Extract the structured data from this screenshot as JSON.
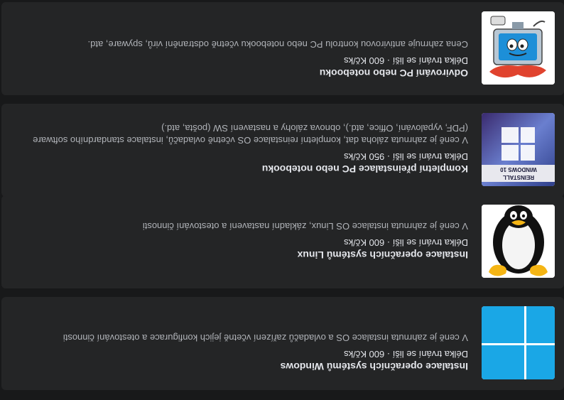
{
  "services": [
    {
      "title": "Instalace operačních systémů Windows",
      "meta": "Délka trvání se liší · 600 Kč/ks",
      "description": "V ceně je zahrnuta instalace OS a ovladačů zařízení včetně jejich konfigurace a otestování činnosti",
      "image_icon": "windows-logo-icon"
    },
    {
      "title": "Instalace operačních systémů Linux",
      "meta": "Délka trvání se liší · 600 Kč/ks",
      "description": "V ceně je zahrnuta instalace OS Linux, základní nastavení a otestování činnosti",
      "image_icon": "linux-penguin-icon"
    },
    {
      "title": "Kompletní přeinstalace PC nebo notebooku",
      "meta": "Délka trvání se liší · 950 Kč/ks",
      "description": "V ceně je zahrnuta záloha dat, kompletní reinstalace OS včetně ovladačů, instalace standardního software (PDF, vypalování, Office, atd.), obnova zálohy a nastavení SW (pošta, atd.)",
      "image_icon": "windows-10-reinstall-icon",
      "image_text": [
        "REINSTALL",
        "WINDOWS 10"
      ]
    },
    {
      "title": "Odvirování PC nebo notebooku",
      "meta": "Délka trvání se liší · 600 Kč/ks",
      "description": "Cena zahrnuje antivirovou kontrolu PC nebo notebooku včetně odstranění virů, spyware, atd.",
      "image_icon": "infected-computer-icon"
    }
  ],
  "colors": {
    "page_bg": "#18191a",
    "card_bg": "#242526",
    "title": "#e4e6eb",
    "description": "#b0b3b8",
    "windows_blue": "#1aa7e6"
  }
}
